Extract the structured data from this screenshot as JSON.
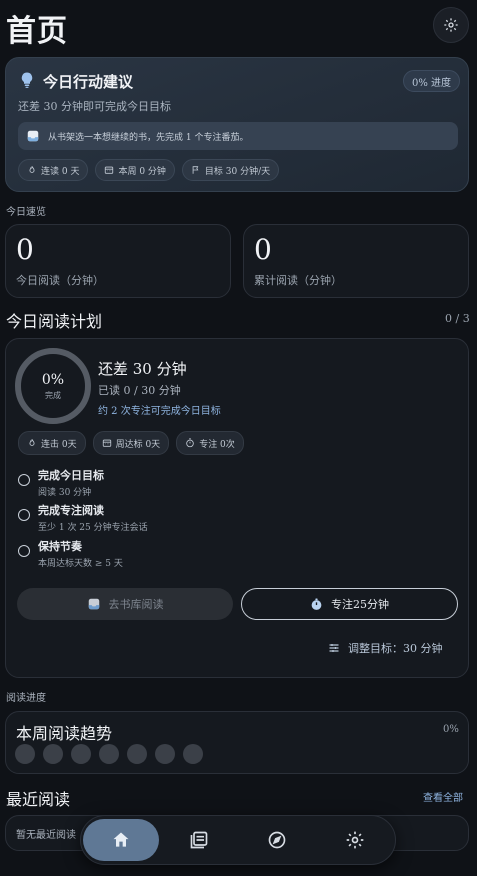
{
  "header": {
    "title": "首页",
    "settings_icon": "gear-icon"
  },
  "suggestion": {
    "title": "今日行动建议",
    "progress_pill": "0% 进度",
    "subtitle": "还差 30 分钟即可完成今日目标",
    "tip": "从书架选一本想继续的书，先完成 1 个专注番茄。",
    "chips": [
      {
        "icon": "flame-icon",
        "label": "连读 0 天"
      },
      {
        "icon": "calendar-icon",
        "label": "本周 0 分钟"
      },
      {
        "icon": "flag-icon",
        "label": "目标 30 分钟/天"
      }
    ]
  },
  "overview": {
    "section_label": "今日速览",
    "today": {
      "value": "0",
      "label": "今日阅读（分钟）"
    },
    "total": {
      "value": "0",
      "label": "累计阅读（分钟）"
    }
  },
  "plan": {
    "title": "今日阅读计划",
    "count": "0 / 3",
    "ring_pct": "0%",
    "ring_label": "完成",
    "progress_fraction": 0,
    "head": "还差 30 分钟",
    "read": "已读 0 / 30 分钟",
    "hint": "约 2 次专注可完成今日目标",
    "chips": [
      {
        "icon": "flame-icon",
        "label": "连击 0天"
      },
      {
        "icon": "calendar-icon",
        "label": "周达标 0天"
      },
      {
        "icon": "timer-icon",
        "label": "专注 0次"
      }
    ],
    "tasks": [
      {
        "title": "完成今日目标",
        "sub": "阅读 30 分钟"
      },
      {
        "title": "完成专注阅读",
        "sub": "至少 1 次 25 分钟专注会话"
      },
      {
        "title": "保持节奏",
        "sub": "本周达标天数 ≥ 5 天"
      }
    ],
    "library_button": "去书库阅读",
    "focus_button": "专注25分钟",
    "adjust": "调整目标：30 分钟"
  },
  "progress": {
    "section_label": "阅读进度",
    "trend_title": "本周阅读趋势",
    "trend_pct": "0%",
    "days": 7
  },
  "recent": {
    "title": "最近阅读",
    "view_all": "查看全部",
    "empty": "暂无最近阅读"
  },
  "nav": [
    {
      "icon": "home-icon",
      "active": true
    },
    {
      "icon": "library-icon",
      "active": false
    },
    {
      "icon": "compass-icon",
      "active": false
    },
    {
      "icon": "gear-icon",
      "active": false
    }
  ],
  "colors": {
    "background": "#0f1217",
    "accent": "#8fb4e0",
    "nav_active": "#5f7895"
  }
}
